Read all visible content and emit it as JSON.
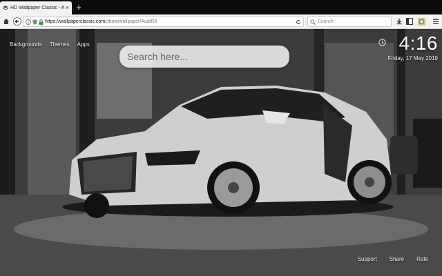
{
  "browser": {
    "tab_title": "HD Wallpaper Classic - Audi",
    "new_tab_symbol": "+",
    "tab_close_symbol": "×",
    "url_host": "https://wallpaperclassic.com",
    "url_path": "/show/wallpaper/AudiR8",
    "search_placeholder": "Search",
    "icons": [
      "home-icon",
      "back-icon",
      "info-icon",
      "lock-icon",
      "reload-icon",
      "search-icon",
      "download-icon",
      "sidebar-icon",
      "extension-icon",
      "menu-icon"
    ]
  },
  "page": {
    "nav": {
      "backgrounds": "Backgrounds",
      "themes": "Themes",
      "apps": "Apps"
    },
    "search": {
      "placeholder": "Search here..."
    },
    "clock": {
      "time": "4:16",
      "date": "Friday, 17 May 2019"
    },
    "footer": {
      "support": "Support",
      "share": "Share",
      "rate": "Rate"
    },
    "background_image": "Grayscale photo of a white Audi R8 sports car in a showroom"
  },
  "colors": {
    "chrome_dark": "#0c0c0c",
    "toolbar": "#f2f2f2",
    "text_light": "#f0f0f0"
  }
}
